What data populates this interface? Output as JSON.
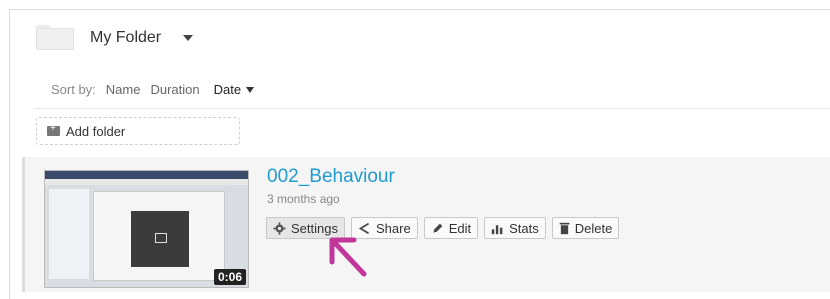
{
  "folder": {
    "title": "My Folder"
  },
  "sort": {
    "label": "Sort by:",
    "options": [
      "Name",
      "Duration",
      "Date"
    ],
    "active": "Date"
  },
  "add_folder": {
    "label": "Add folder"
  },
  "video": {
    "title": "002_Behaviour",
    "age": "3 months ago",
    "duration": "0:06",
    "actions": [
      "Settings",
      "Share",
      "Edit",
      "Stats",
      "Delete"
    ]
  },
  "colors": {
    "link": "#1e9bd0",
    "annotation_arrow": "#c2369c"
  }
}
